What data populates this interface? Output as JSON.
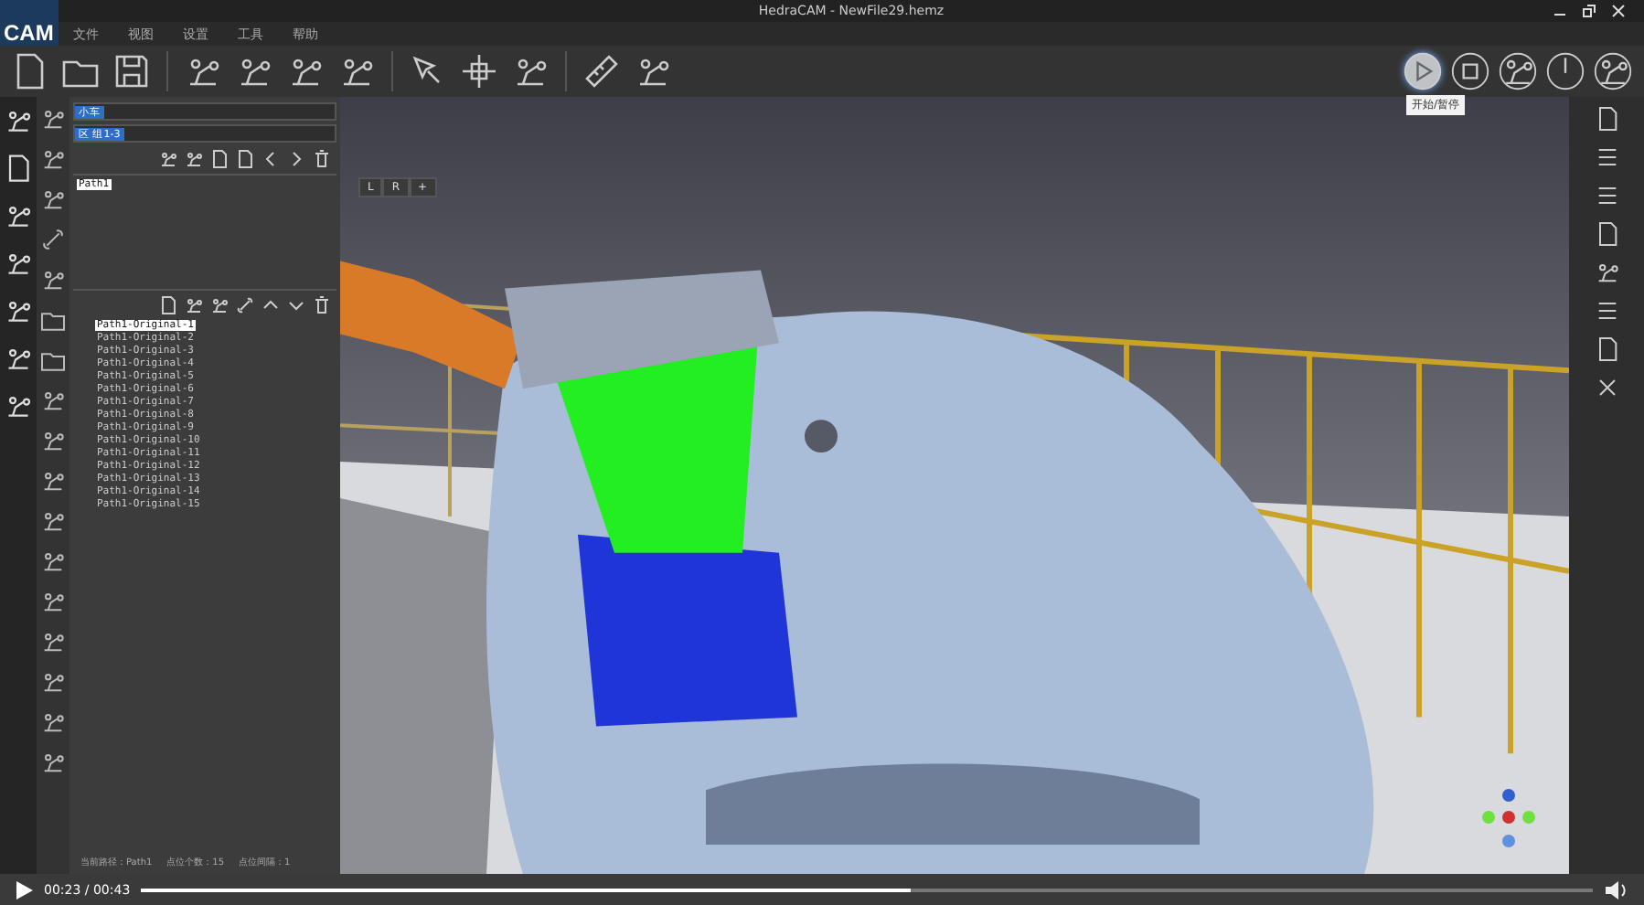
{
  "window": {
    "logo": "CAM",
    "title": "HedraCAM - NewFile29.hemz"
  },
  "menu": [
    "文件",
    "视图",
    "设置",
    "工具",
    "帮助"
  ],
  "playback_tooltip": "开始/暂停",
  "panel": {
    "fields": [
      {
        "value": "小车"
      },
      {
        "value": "区 组1-3"
      }
    ],
    "tree": [
      {
        "label": "Path1",
        "selected": true
      }
    ],
    "paths": [
      {
        "label": "Path1-Original-1",
        "selected": true
      },
      {
        "label": "Path1-Original-2",
        "selected": false
      },
      {
        "label": "Path1-Original-3",
        "selected": false
      },
      {
        "label": "Path1-Original-4",
        "selected": false
      },
      {
        "label": "Path1-Original-5",
        "selected": false
      },
      {
        "label": "Path1-Original-6",
        "selected": false
      },
      {
        "label": "Path1-Original-7",
        "selected": false
      },
      {
        "label": "Path1-Original-8",
        "selected": false
      },
      {
        "label": "Path1-Original-9",
        "selected": false
      },
      {
        "label": "Path1-Original-10",
        "selected": false
      },
      {
        "label": "Path1-Original-11",
        "selected": false
      },
      {
        "label": "Path1-Original-12",
        "selected": false
      },
      {
        "label": "Path1-Original-13",
        "selected": false
      },
      {
        "label": "Path1-Original-14",
        "selected": false
      },
      {
        "label": "Path1-Original-15",
        "selected": false
      }
    ],
    "status": [
      "当前路径：Path1",
      "点位个数：15",
      "点位间隔：1"
    ]
  },
  "viewport": {
    "tabs": [
      "L",
      "R",
      "+"
    ],
    "kind": "picture"
  },
  "video": {
    "time": "00:23 / 00:43",
    "level": 0.53
  }
}
